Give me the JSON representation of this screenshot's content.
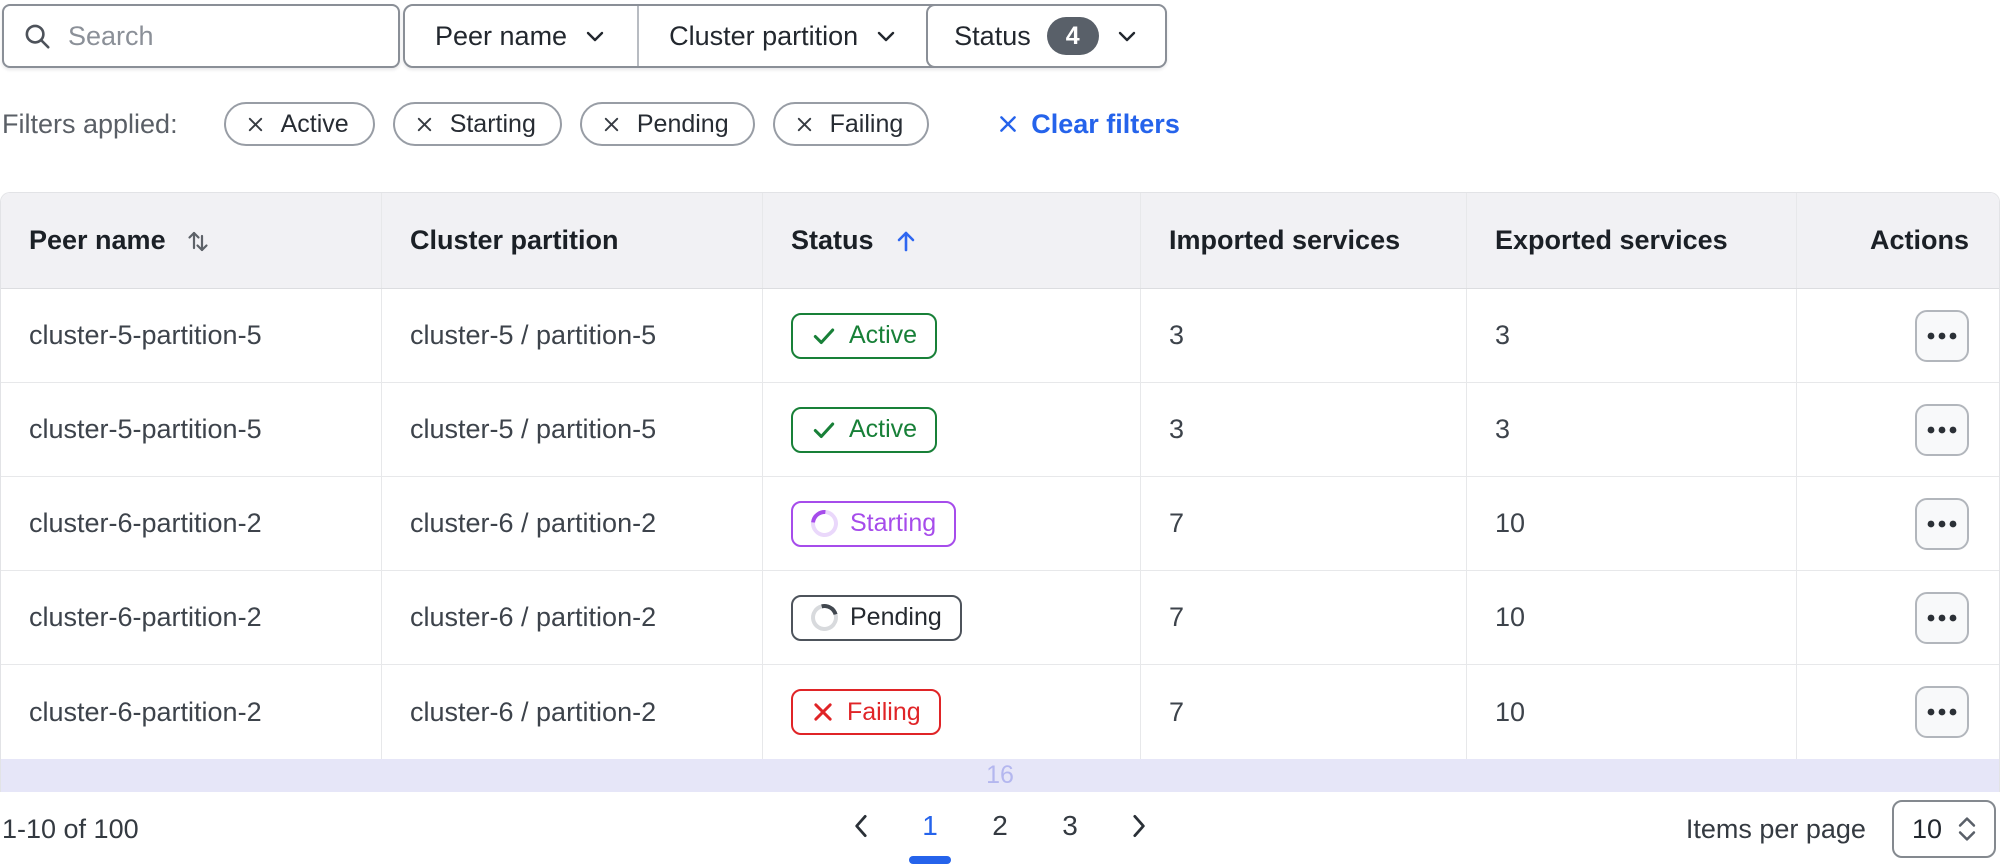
{
  "toolbar": {
    "search": {
      "placeholder": "Search"
    },
    "filters": [
      {
        "label": "Peer name"
      },
      {
        "label": "Cluster partition"
      },
      {
        "label": "Status",
        "count": "4"
      }
    ]
  },
  "applied_filters": {
    "label": "Filters applied:",
    "chips": [
      {
        "label": "Active"
      },
      {
        "label": "Starting"
      },
      {
        "label": "Pending"
      },
      {
        "label": "Failing"
      }
    ],
    "clear_label": "Clear filters"
  },
  "table": {
    "columns": [
      {
        "label": "Peer name",
        "sort": "both"
      },
      {
        "label": "Cluster partition",
        "sort": "none"
      },
      {
        "label": "Status",
        "sort": "asc"
      },
      {
        "label": "Imported services",
        "sort": "none"
      },
      {
        "label": "Exported services",
        "sort": "none"
      },
      {
        "label": "Actions",
        "sort": "none"
      }
    ],
    "rows": [
      {
        "peer": "cluster-5-partition-5",
        "partition": "cluster-5 / partition-5",
        "status": {
          "label": "Active",
          "kind": "active"
        },
        "imported": "3",
        "exported": "3"
      },
      {
        "peer": "cluster-5-partition-5",
        "partition": "cluster-5 / partition-5",
        "status": {
          "label": "Active",
          "kind": "active"
        },
        "imported": "3",
        "exported": "3"
      },
      {
        "peer": "cluster-6-partition-2",
        "partition": "cluster-6 / partition-2",
        "status": {
          "label": "Starting",
          "kind": "starting"
        },
        "imported": "7",
        "exported": "10"
      },
      {
        "peer": "cluster-6-partition-2",
        "partition": "cluster-6 / partition-2",
        "status": {
          "label": "Pending",
          "kind": "pending"
        },
        "imported": "7",
        "exported": "10"
      },
      {
        "peer": "cluster-6-partition-2",
        "partition": "cluster-6 / partition-2",
        "status": {
          "label": "Failing",
          "kind": "failing"
        },
        "imported": "7",
        "exported": "10"
      }
    ],
    "overlay_count": "16"
  },
  "pagination": {
    "range": "1-10 of 100",
    "pages": [
      "1",
      "2",
      "3"
    ],
    "current_page": "1",
    "items_per_page_label": "Items per page",
    "items_per_page_value": "10"
  },
  "colors": {
    "accent_blue": "#2563eb",
    "green": "#188038",
    "purple": "#a64ceb",
    "red": "#e02427",
    "badge_count_bg": "#596069",
    "lavender_bar_bg": "#e6e6f8",
    "lavender_bar_text": "#b4b7ef"
  }
}
